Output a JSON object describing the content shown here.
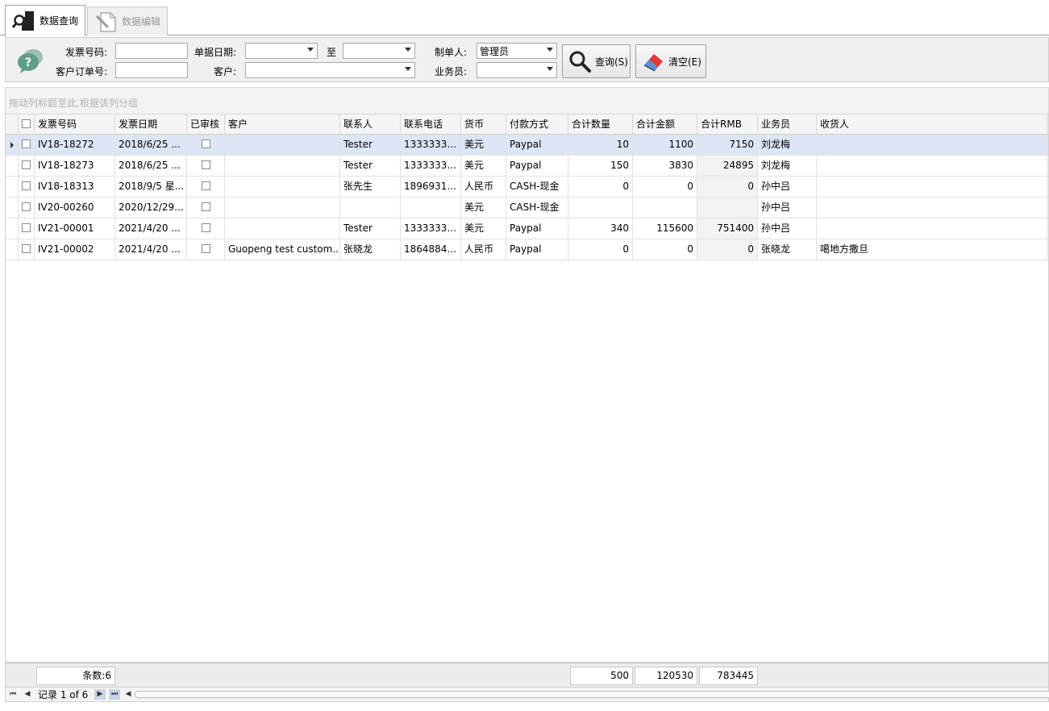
{
  "tabs": [
    {
      "label": "数据查询",
      "active": true,
      "icon": "search-document-icon"
    },
    {
      "label": "数据编辑",
      "active": false,
      "icon": "edit-document-icon"
    }
  ],
  "filter": {
    "invoice_no_label": "发票号码:",
    "invoice_no_value": "",
    "customer_order_label": "客户订单号:",
    "customer_order_value": "",
    "date_label": "单据日期:",
    "date_from": "",
    "to_label": "至",
    "date_to": "",
    "customer_label": "客户:",
    "customer_value": "",
    "creator_label": "制单人:",
    "creator_value": "管理员",
    "salesman_label": "业务员:",
    "salesman_value": "",
    "query_button": "查询(S)",
    "clear_button": "清空(E)"
  },
  "grid": {
    "group_hint": "拖动列标题至此,根据该列分组",
    "columns": [
      "发票号码",
      "发票日期",
      "已审核",
      "客户",
      "联系人",
      "联系电话",
      "货币",
      "付款方式",
      "合计数量",
      "合计金额",
      "合计RMB",
      "业务员",
      "收货人"
    ],
    "rows": [
      {
        "invoice": "IV18-18272",
        "date": "2018/6/25 ...",
        "customer": "",
        "contact": "Tester",
        "phone": "1333333...",
        "currency": "美元",
        "payment": "Paypal",
        "qty": "10",
        "amount": "1100",
        "rmb": "7150",
        "salesman": "刘龙梅",
        "receiver": ""
      },
      {
        "invoice": "IV18-18273",
        "date": "2018/6/25 ...",
        "customer": "",
        "contact": "Tester",
        "phone": "1333333...",
        "currency": "美元",
        "payment": "Paypal",
        "qty": "150",
        "amount": "3830",
        "rmb": "24895",
        "salesman": "刘龙梅",
        "receiver": ""
      },
      {
        "invoice": "IV18-18313",
        "date": "2018/9/5 星...",
        "customer": "",
        "contact": "张先生",
        "phone": "1896931...",
        "currency": "人民币",
        "payment": "CASH-现金",
        "qty": "0",
        "amount": "0",
        "rmb": "0",
        "salesman": "孙中吕",
        "receiver": ""
      },
      {
        "invoice": "IV20-00260",
        "date": "2020/12/29...",
        "customer": "",
        "contact": "",
        "phone": "",
        "currency": "美元",
        "payment": "CASH-现金",
        "qty": "",
        "amount": "",
        "rmb": "",
        "salesman": "孙中吕",
        "receiver": ""
      },
      {
        "invoice": "IV21-00001",
        "date": "2021/4/20 ...",
        "customer": "",
        "contact": "Tester",
        "phone": "1333333...",
        "currency": "美元",
        "payment": "Paypal",
        "qty": "340",
        "amount": "115600",
        "rmb": "751400",
        "salesman": "孙中吕",
        "receiver": ""
      },
      {
        "invoice": "IV21-00002",
        "date": "2021/4/20 ...",
        "customer": "Guopeng test custom...",
        "contact": "张晓龙",
        "phone": "1864884...",
        "currency": "人民币",
        "payment": "Paypal",
        "qty": "0",
        "amount": "0",
        "rmb": "0",
        "salesman": "张晓龙",
        "receiver": "噶地方撒旦"
      }
    ]
  },
  "summary": {
    "count": "条数:6",
    "qty_total": "500",
    "amount_total": "120530",
    "rmb_total": "783445"
  },
  "navigator": {
    "record_text": "记录 1 of 6"
  },
  "colors": {
    "selected_row": "#dde6f6",
    "panel_bg": "#f0f0f0"
  }
}
